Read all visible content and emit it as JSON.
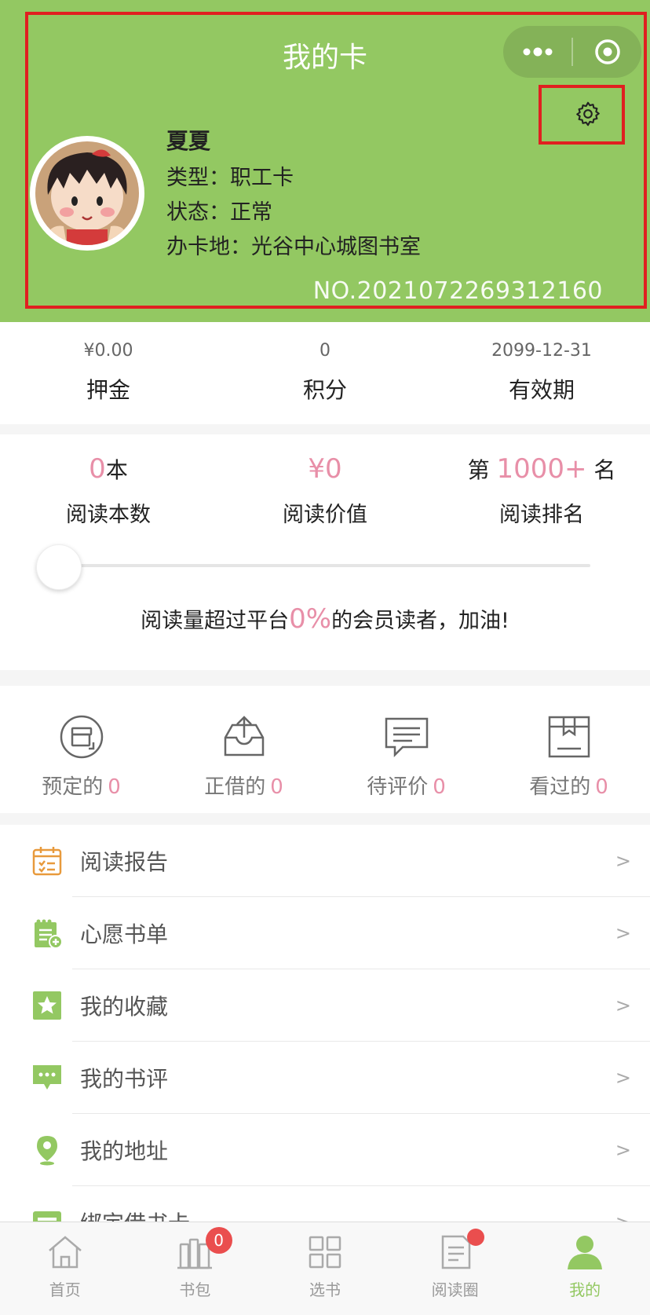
{
  "header": {
    "title": "我的卡",
    "more_icon": "more-dots-icon",
    "close_icon": "target-circle-icon",
    "settings_icon": "gear-icon",
    "accent_color": "#93c862",
    "highlight_color": "#e02020"
  },
  "profile": {
    "name": "夏夏",
    "type": "类型：职工卡",
    "status": "状态：正常",
    "location": "办卡地：光谷中心城图书室",
    "card_no": "NO.2021072269312160"
  },
  "stats": [
    {
      "value": "¥0.00",
      "label": "押金"
    },
    {
      "value": "0",
      "label": "积分"
    },
    {
      "value": "2099-12-31",
      "label": "有效期"
    }
  ],
  "reading": {
    "count_value": "0",
    "count_unit": "本",
    "count_label": "阅读本数",
    "worth_value": "¥0",
    "worth_label": "阅读价值",
    "rank_prefix": "第",
    "rank_value": "1000+",
    "rank_suffix": "名",
    "rank_label": "阅读排名",
    "progress_percent": 0,
    "msg_pre": "阅读量超过平台",
    "msg_pct": "0%",
    "msg_post": "的会员读者，加油!",
    "highlight_color": "#e88fa8"
  },
  "orders": [
    {
      "label": "预定的",
      "count": "0",
      "icon": "reserve-icon"
    },
    {
      "label": "正借的",
      "count": "0",
      "icon": "inbox-upload-icon"
    },
    {
      "label": "待评价",
      "count": "0",
      "icon": "comment-icon"
    },
    {
      "label": "看过的",
      "count": "0",
      "icon": "book-box-icon"
    }
  ],
  "menu": [
    {
      "label": "阅读报告",
      "icon": "calendar-report-icon",
      "arrow": ">"
    },
    {
      "label": "心愿书单",
      "icon": "wishlist-icon",
      "arrow": ">"
    },
    {
      "label": "我的收藏",
      "icon": "star-icon",
      "arrow": ">"
    },
    {
      "label": "我的书评",
      "icon": "chat-bubble-icon",
      "arrow": ">"
    },
    {
      "label": "我的地址",
      "icon": "location-pin-icon",
      "arrow": ">"
    },
    {
      "label": "绑定借书卡",
      "icon": "card-icon",
      "arrow": ">"
    }
  ],
  "tabs": [
    {
      "label": "首页",
      "icon": "home-icon"
    },
    {
      "label": "书包",
      "icon": "bookbag-icon",
      "badge": "0"
    },
    {
      "label": "选书",
      "icon": "grid-icon"
    },
    {
      "label": "阅读圈",
      "icon": "document-icon"
    },
    {
      "label": "我的",
      "icon": "person-icon"
    }
  ]
}
